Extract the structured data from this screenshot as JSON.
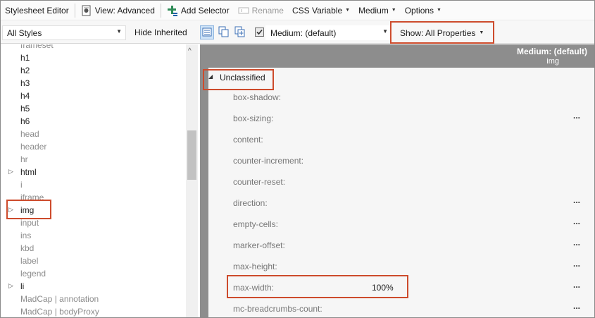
{
  "toolbar": {
    "app_title": "Stylesheet Editor",
    "view": "View: Advanced",
    "add_selector": "Add Selector",
    "rename": "Rename",
    "css_variable": "CSS Variable",
    "medium": "Medium",
    "options": "Options"
  },
  "filterbar": {
    "styles_filter": "All Styles",
    "hide_inherited": "Hide Inherited",
    "medium_filter": "Medium: (default)",
    "medium_checked": true,
    "show_properties": "Show: All Properties"
  },
  "tree": {
    "items": [
      {
        "label": "frameset",
        "style": "grey",
        "expandable": false
      },
      {
        "label": "h1",
        "style": "dark",
        "expandable": false
      },
      {
        "label": "h2",
        "style": "dark",
        "expandable": false
      },
      {
        "label": "h3",
        "style": "dark",
        "expandable": false
      },
      {
        "label": "h4",
        "style": "dark",
        "expandable": false
      },
      {
        "label": "h5",
        "style": "dark",
        "expandable": false
      },
      {
        "label": "h6",
        "style": "dark",
        "expandable": false
      },
      {
        "label": "head",
        "style": "grey",
        "expandable": false
      },
      {
        "label": "header",
        "style": "grey",
        "expandable": false
      },
      {
        "label": "hr",
        "style": "grey",
        "expandable": false
      },
      {
        "label": "html",
        "style": "dark",
        "expandable": true
      },
      {
        "label": "i",
        "style": "grey",
        "expandable": false
      },
      {
        "label": "iframe",
        "style": "grey",
        "expandable": false
      },
      {
        "label": "img",
        "style": "dark",
        "expandable": true
      },
      {
        "label": "input",
        "style": "grey",
        "expandable": false
      },
      {
        "label": "ins",
        "style": "grey",
        "expandable": false
      },
      {
        "label": "kbd",
        "style": "grey",
        "expandable": false
      },
      {
        "label": "label",
        "style": "grey",
        "expandable": false
      },
      {
        "label": "legend",
        "style": "grey",
        "expandable": false
      },
      {
        "label": "li",
        "style": "dark",
        "expandable": true
      },
      {
        "label": "MadCap | annotation",
        "style": "grey",
        "expandable": false
      },
      {
        "label": "MadCap | bodyProxy",
        "style": "grey",
        "expandable": false
      }
    ]
  },
  "properties": {
    "header_medium": "Medium: (default)",
    "header_selector": "img",
    "group": "Unclassified",
    "rows": [
      {
        "name": "box-shadow:",
        "value": "",
        "more": ""
      },
      {
        "name": "box-sizing:",
        "value": "",
        "more": "..."
      },
      {
        "name": "content:",
        "value": "",
        "more": ""
      },
      {
        "name": "counter-increment:",
        "value": "",
        "more": ""
      },
      {
        "name": "counter-reset:",
        "value": "",
        "more": ""
      },
      {
        "name": "direction:",
        "value": "",
        "more": "..."
      },
      {
        "name": "empty-cells:",
        "value": "",
        "more": "..."
      },
      {
        "name": "marker-offset:",
        "value": "",
        "more": "..."
      },
      {
        "name": "max-height:",
        "value": "",
        "more": "..."
      },
      {
        "name": "max-width:",
        "value": "100%",
        "more": "..."
      },
      {
        "name": "mc-breadcrumbs-count:",
        "value": "",
        "more": "..."
      }
    ]
  },
  "colors": {
    "highlight": "#cd4b2c",
    "header_bg": "#8d8d8d",
    "grid_bg": "#f6f6f6"
  }
}
